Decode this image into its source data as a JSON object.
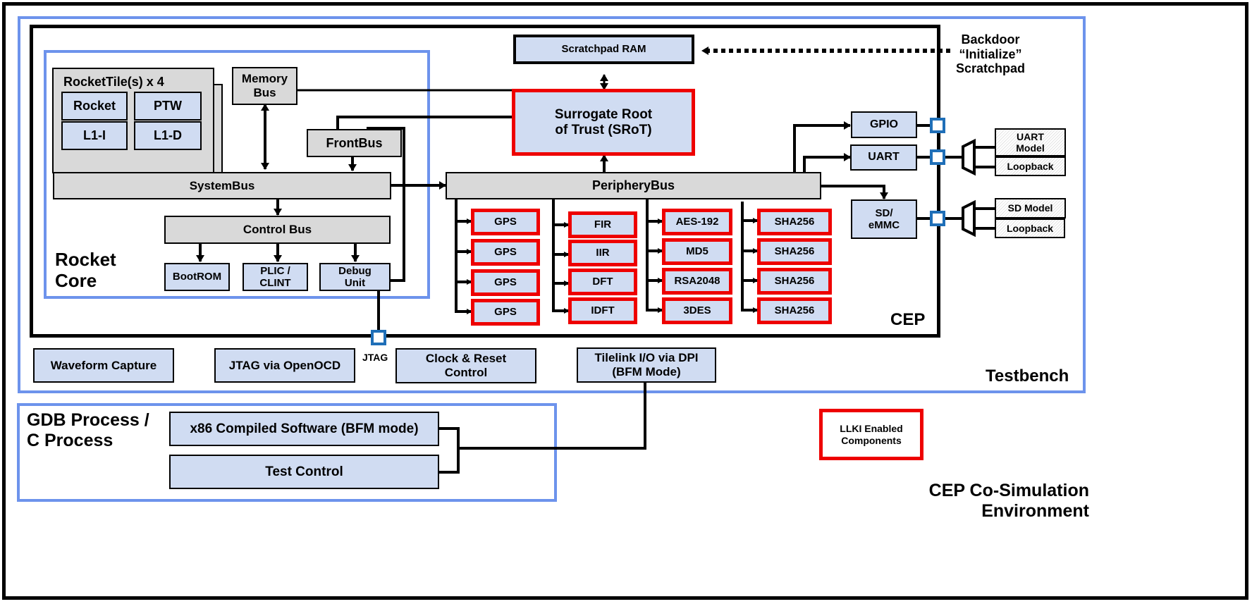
{
  "environment": {
    "title_line1": "CEP Co-Simulation",
    "title_line2": "Environment"
  },
  "testbench": {
    "title": "Testbench",
    "waveform_capture": "Waveform Capture",
    "jtag_openocd": "JTAG via OpenOCD",
    "jtag_port_label": "JTAG",
    "clock_reset_line1": "Clock & Reset",
    "clock_reset_line2": "Control",
    "tilelink_line1": "Tilelink I/O via DPI",
    "tilelink_line2": "(BFM Mode)"
  },
  "cep": {
    "title": "CEP",
    "scratchpad": "Scratchpad RAM",
    "backdoor_line1": "Backdoor",
    "backdoor_line2": "“Initialize”",
    "backdoor_line3": "Scratchpad",
    "srot_line1": "Surrogate Root",
    "srot_line2": "of Trust (SRoT)",
    "periphery_bus": "PeripheryBus",
    "gpio": "GPIO",
    "uart": "UART",
    "sd_line1": "SD/",
    "sd_line2": "eMMC",
    "uart_model_line1": "UART",
    "uart_model_line2": "Model",
    "uart_loopback": "Loopback",
    "sd_model": "SD Model",
    "sd_loopback": "Loopback",
    "accelerator_columns": [
      [
        "GPS",
        "GPS",
        "GPS",
        "GPS"
      ],
      [
        "FIR",
        "IIR",
        "DFT",
        "IDFT"
      ],
      [
        "AES-192",
        "MD5",
        "RSA2048",
        "3DES"
      ],
      [
        "SHA256",
        "SHA256",
        "SHA256",
        "SHA256"
      ]
    ]
  },
  "rocket_core": {
    "title_line1": "Rocket",
    "title_line2": "Core",
    "tiles_title": "RocketTile(s) x 4",
    "rocket": "Rocket",
    "ptw": "PTW",
    "l1i": "L1-I",
    "l1d": "L1-D",
    "memory_bus_line1": "Memory",
    "memory_bus_line2": "Bus",
    "front_bus": "FrontBus",
    "system_bus": "SystemBus",
    "control_bus": "Control Bus",
    "bootrom": "BootROM",
    "plic_line1": "PLIC /",
    "plic_line2": "CLINT",
    "debug_line1": "Debug",
    "debug_line2": "Unit"
  },
  "gdb_process": {
    "title_line1": "GDB Process /",
    "title_line2": "C Process",
    "x86_software": "x86 Compiled Software (BFM mode)",
    "test_control": "Test Control"
  },
  "legend": {
    "line1": "LLKI Enabled",
    "line2": "Components",
    "color": "#ee0000"
  },
  "colors": {
    "block_fill": "#d0dcf2",
    "bus_fill": "#d9d9d9",
    "frame_blue": "#6d93ec",
    "port_blue": "#1f6fb8",
    "llki_red": "#ee0000"
  }
}
